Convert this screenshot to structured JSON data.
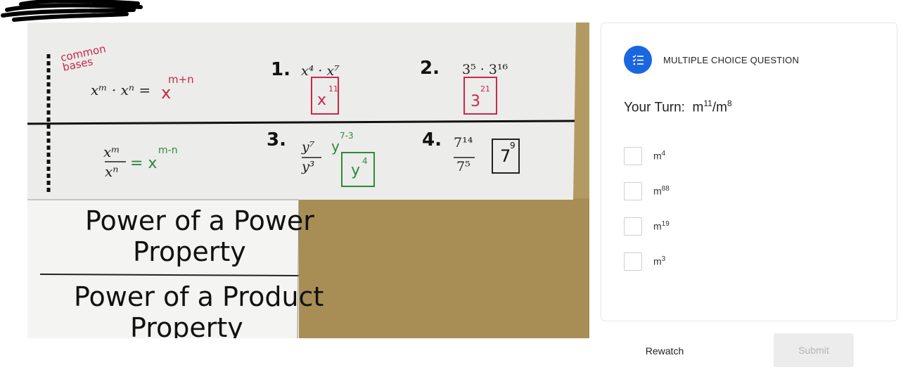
{
  "photo": {
    "common_bases_note": "common bases",
    "rule1": {
      "lhs": "xᵐ · xⁿ =",
      "result": "x",
      "exp": "m+n"
    },
    "rule2": {
      "num": "xᵐ",
      "den": "xⁿ",
      "result": "= x",
      "exp": "m-n"
    },
    "problems": [
      {
        "num": "1.",
        "expr": "x⁴ · x⁷",
        "answer": "x",
        "answer_exp": "11"
      },
      {
        "num": "2.",
        "expr": "3⁵ · 3¹⁶",
        "answer": "3",
        "answer_exp": "21"
      },
      {
        "num": "3.",
        "top": "y⁷",
        "bottom": "y³",
        "note": "y",
        "note_exp": "7-3",
        "answer": "y",
        "answer_exp": "4"
      },
      {
        "num": "4.",
        "top": "7¹⁴",
        "bottom": "7⁵",
        "answer": "7",
        "answer_exp": "9"
      }
    ],
    "heading1_line1": "Power of a Power",
    "heading1_line2": "Property",
    "heading2_line1": "Power of a Product",
    "heading2_line2": "Property"
  },
  "question": {
    "type_label": "MULTIPLE CHOICE QUESTION",
    "prompt_prefix": "Your Turn:",
    "prompt_base1": "m",
    "prompt_exp1": "11",
    "prompt_slash": "/m",
    "prompt_exp2": "8",
    "options": [
      {
        "base": "m",
        "exp": "4"
      },
      {
        "base": "m",
        "exp": "88"
      },
      {
        "base": "m",
        "exp": "19"
      },
      {
        "base": "m",
        "exp": "3"
      }
    ]
  },
  "actions": {
    "rewatch_label": "Rewatch",
    "submit_label": "Submit"
  },
  "colors": {
    "accent": "#1a66e0",
    "ink_red": "#c8284a",
    "ink_green": "#2e8a3c",
    "table": "#b39a62"
  }
}
